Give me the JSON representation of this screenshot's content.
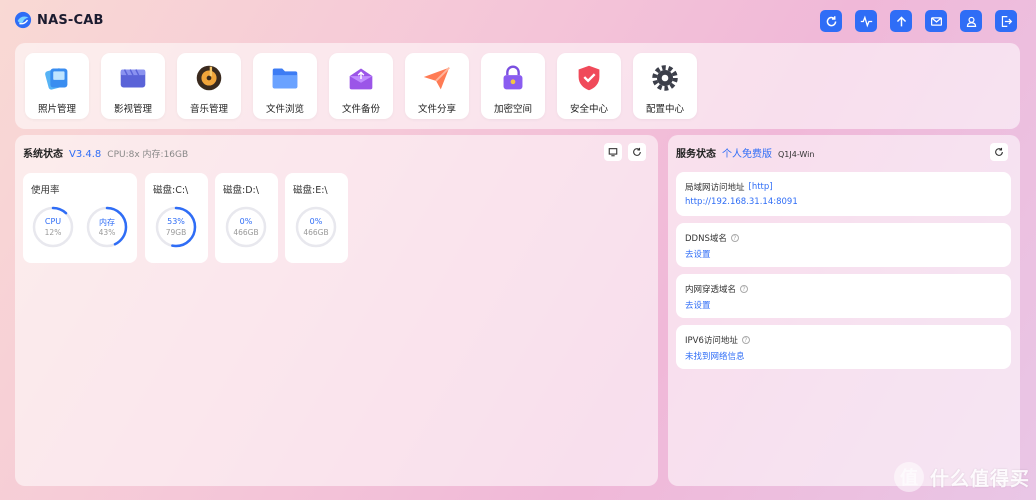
{
  "header": {
    "title": "NAS-CAB",
    "icons": [
      "refresh-icon",
      "activity-icon",
      "upload-icon",
      "mail-icon",
      "user-icon",
      "logout-icon"
    ]
  },
  "apps": [
    {
      "label": "照片管理",
      "icon": "photo-icon"
    },
    {
      "label": "影视管理",
      "icon": "video-icon"
    },
    {
      "label": "音乐管理",
      "icon": "music-icon"
    },
    {
      "label": "文件浏览",
      "icon": "folder-icon"
    },
    {
      "label": "文件备份",
      "icon": "backup-icon"
    },
    {
      "label": "文件分享",
      "icon": "share-icon"
    },
    {
      "label": "加密空间",
      "icon": "lock-icon"
    },
    {
      "label": "安全中心",
      "icon": "shield-icon"
    },
    {
      "label": "配置中心",
      "icon": "gear-icon"
    }
  ],
  "system": {
    "title": "系统状态",
    "version": "V3.4.8",
    "specs": "CPU:8x 内存:16GB",
    "usage": {
      "title": "使用率",
      "cpu": {
        "label": "CPU",
        "value": "12%",
        "percent": 12
      },
      "mem": {
        "label": "内存",
        "value": "43%",
        "percent": 43
      }
    },
    "disks": [
      {
        "title": "磁盘:C:\\",
        "percent_label": "53%",
        "size": "79GB",
        "percent": 53
      },
      {
        "title": "磁盘:D:\\",
        "percent_label": "0%",
        "size": "466GB",
        "percent": 0
      },
      {
        "title": "磁盘:E:\\",
        "percent_label": "0%",
        "size": "466GB",
        "percent": 0
      }
    ]
  },
  "service": {
    "title": "服务状态",
    "plan": "个人免费版",
    "device": "Q1J4-Win",
    "items": [
      {
        "label": "局域网访问地址",
        "tag": "[http]",
        "value": "http://192.168.31.14:8091"
      },
      {
        "label": "DDNS域名",
        "help": "?",
        "value": "去设置"
      },
      {
        "label": "内网穿透域名",
        "help": "?",
        "value": "去设置"
      },
      {
        "label": "IPV6访问地址",
        "help": "?",
        "value": "未找到网络信息"
      }
    ]
  },
  "watermark": {
    "mark": "值",
    "text": "什么值得买"
  },
  "colors": {
    "accent": "#2f6df6",
    "track": "#e8e8ee"
  }
}
